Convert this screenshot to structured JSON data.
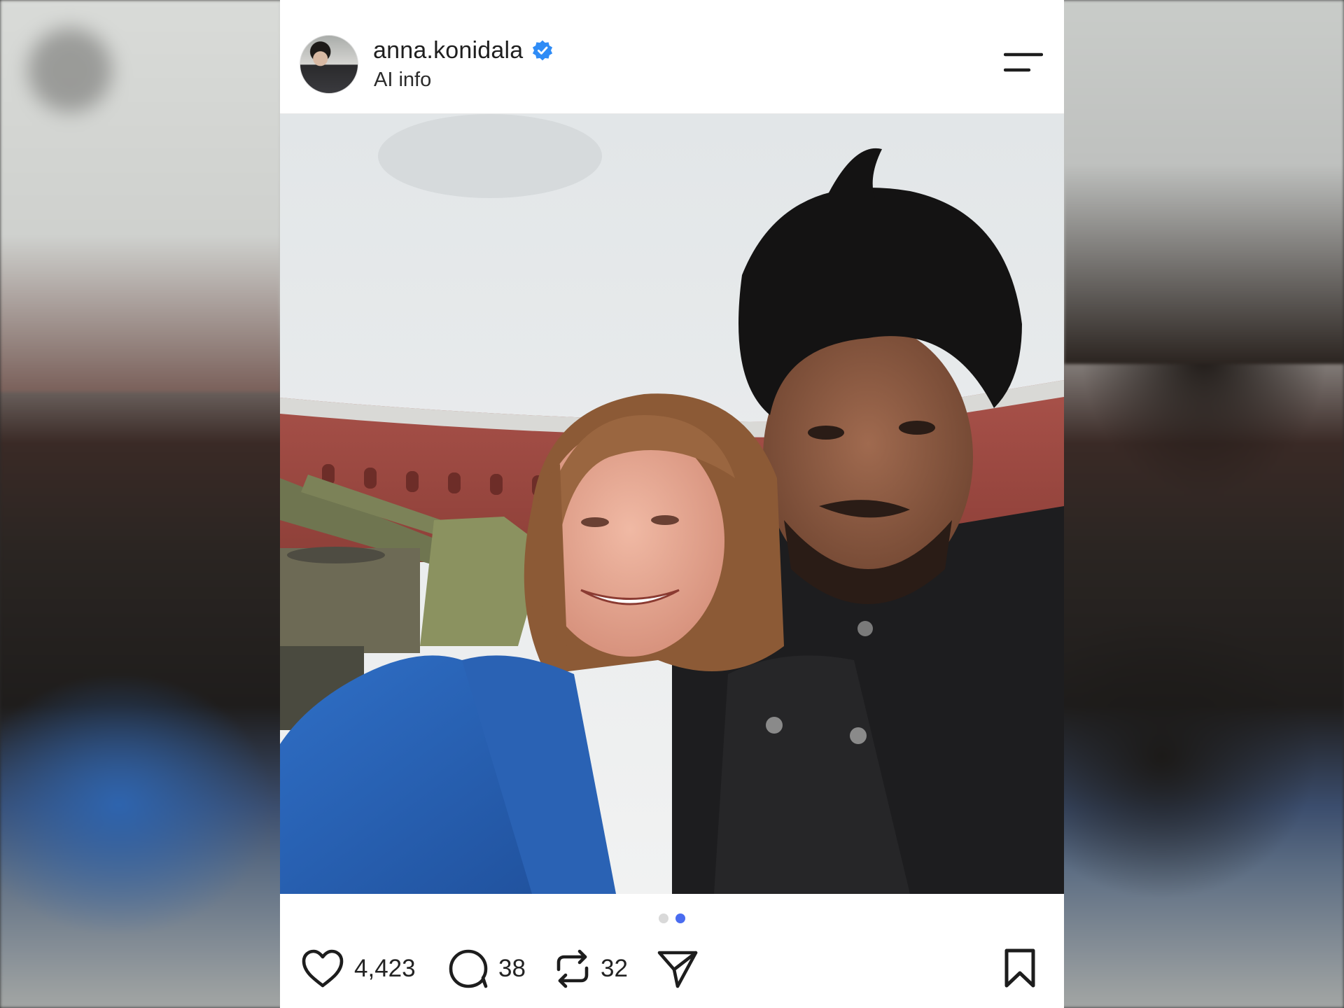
{
  "post": {
    "username": "anna.konidala",
    "verified": true,
    "subtitle": "AI info",
    "photo_description_icon": "post-photo"
  },
  "carousel": {
    "total": 2,
    "active_index": 1
  },
  "actions": {
    "likes": "4,423",
    "comments": "38",
    "reposts": "32"
  },
  "icons": {
    "menu": "menu-icon",
    "verified": "verified-badge-icon",
    "like": "heart-icon",
    "comment": "comment-icon",
    "repost": "repost-icon",
    "share": "send-icon",
    "save": "bookmark-icon"
  },
  "colors": {
    "verified": "#2f8cf6",
    "active_dot": "#4a6cf0",
    "inactive_dot": "#d9d9d9"
  }
}
